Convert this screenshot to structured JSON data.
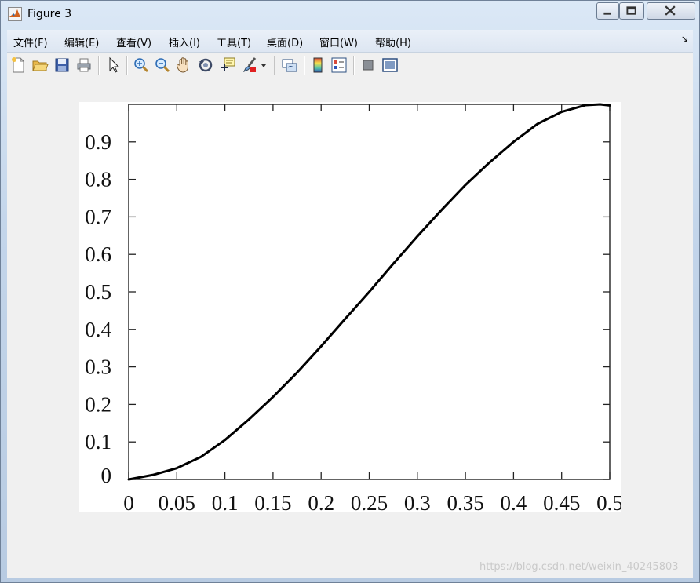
{
  "window": {
    "title": "Figure 3",
    "icons": {
      "app": "matlab-logo-icon",
      "minimize": "minimize-icon",
      "maximize": "maximize-icon",
      "close": "close-icon"
    }
  },
  "menu": {
    "items": [
      {
        "label": "文件(F)"
      },
      {
        "label": "编辑(E)"
      },
      {
        "label": "查看(V)"
      },
      {
        "label": "插入(I)"
      },
      {
        "label": "工具(T)"
      },
      {
        "label": "桌面(D)"
      },
      {
        "label": "窗口(W)"
      },
      {
        "label": "帮助(H)"
      }
    ],
    "overflow_icon": "dock-arrow-icon"
  },
  "toolbar": {
    "icons": [
      "new-figure-icon",
      "open-file-icon",
      "save-icon",
      "print-icon",
      "edit-plot-arrow-icon",
      "zoom-in-icon",
      "zoom-out-icon",
      "pan-hand-icon",
      "rotate-3d-icon",
      "data-cursor-icon",
      "brush-icon",
      "link-plot-icon",
      "colorbar-icon",
      "legend-icon",
      "hide-plot-tools-icon",
      "show-plot-tools-icon"
    ]
  },
  "chart_data": {
    "type": "line",
    "title": "",
    "xlabel": "",
    "ylabel": "",
    "xlim": [
      0,
      0.5
    ],
    "ylim": [
      0,
      1
    ],
    "grid": false,
    "xticks": [
      "0",
      "0.05",
      "0.1",
      "0.15",
      "0.2",
      "0.25",
      "0.3",
      "0.35",
      "0.4",
      "0.45",
      "0.5"
    ],
    "yticks": [
      "0",
      "0.1",
      "0.2",
      "0.3",
      "0.4",
      "0.5",
      "0.6",
      "0.7",
      "0.8",
      "0.9"
    ],
    "series": [
      {
        "color": "#000000",
        "x": [
          0,
          0.025,
          0.05,
          0.075,
          0.1,
          0.125,
          0.15,
          0.175,
          0.2,
          0.225,
          0.25,
          0.275,
          0.3,
          0.325,
          0.35,
          0.375,
          0.4,
          0.425,
          0.45,
          0.475,
          0.49,
          0.5
        ],
        "y": [
          0,
          0.012,
          0.03,
          0.06,
          0.105,
          0.16,
          0.22,
          0.285,
          0.355,
          0.428,
          0.5,
          0.575,
          0.648,
          0.718,
          0.785,
          0.845,
          0.9,
          0.948,
          0.98,
          0.998,
          1.0,
          0.997
        ]
      }
    ]
  },
  "watermark": "https://blog.csdn.net/weixin_40245803"
}
